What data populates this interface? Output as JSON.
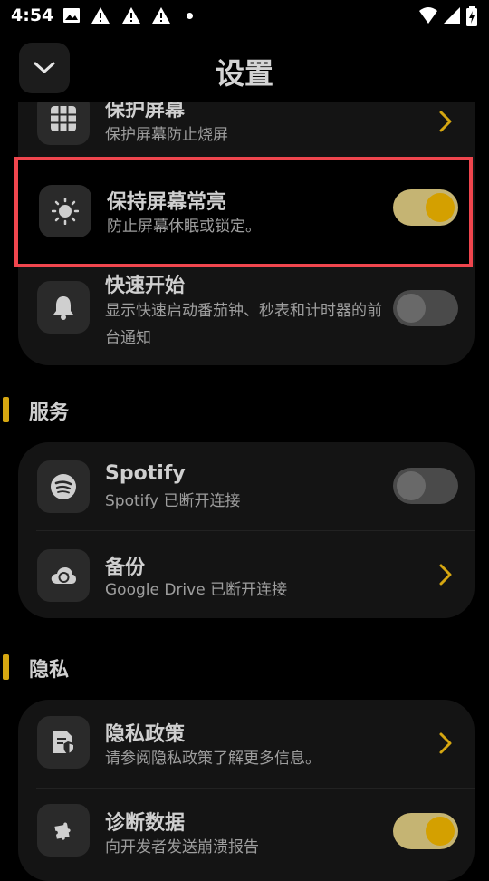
{
  "status_bar": {
    "time": "4:54",
    "left_icons": [
      "image-icon",
      "warning-icon",
      "warning-icon",
      "warning-icon",
      "dot-icon"
    ],
    "right_icons": [
      "wifi-icon",
      "signal-icon",
      "battery-charging-icon"
    ]
  },
  "header": {
    "title": "设置",
    "back_icon": "chevron-down-icon"
  },
  "general": {
    "screen_saver": {
      "title": "保护屏幕",
      "subtitle": "保护屏幕防止烧屏",
      "icon": "grid-icon"
    },
    "keep_screen_on": {
      "title": "保持屏幕常亮",
      "subtitle": "防止屏幕休眠或锁定。",
      "icon": "sun-icon",
      "enabled": true
    },
    "quick_start": {
      "title": "快速开始",
      "subtitle": "显示快速启动番茄钟、秒表和计时器的前台通知",
      "icon": "bell-icon",
      "enabled": false
    }
  },
  "services": {
    "header": "服务",
    "spotify": {
      "title": "Spotify",
      "subtitle": "Spotify 已断开连接",
      "icon": "spotify-icon",
      "enabled": false
    },
    "backup": {
      "title": "备份",
      "subtitle": "Google Drive 已断开连接",
      "icon": "cloud-sync-icon"
    }
  },
  "privacy": {
    "header": "隐私",
    "policy": {
      "title": "隐私政策",
      "subtitle": "请参阅隐私政策了解更多信息。",
      "icon": "document-shield-icon"
    },
    "diagnostics": {
      "title": "诊断数据",
      "subtitle": "向开发者发送崩溃报告",
      "icon": "puzzle-icon",
      "enabled": true
    }
  },
  "colors": {
    "accent": "#d4a000",
    "highlight": "#f0464e",
    "card": "#141414"
  }
}
